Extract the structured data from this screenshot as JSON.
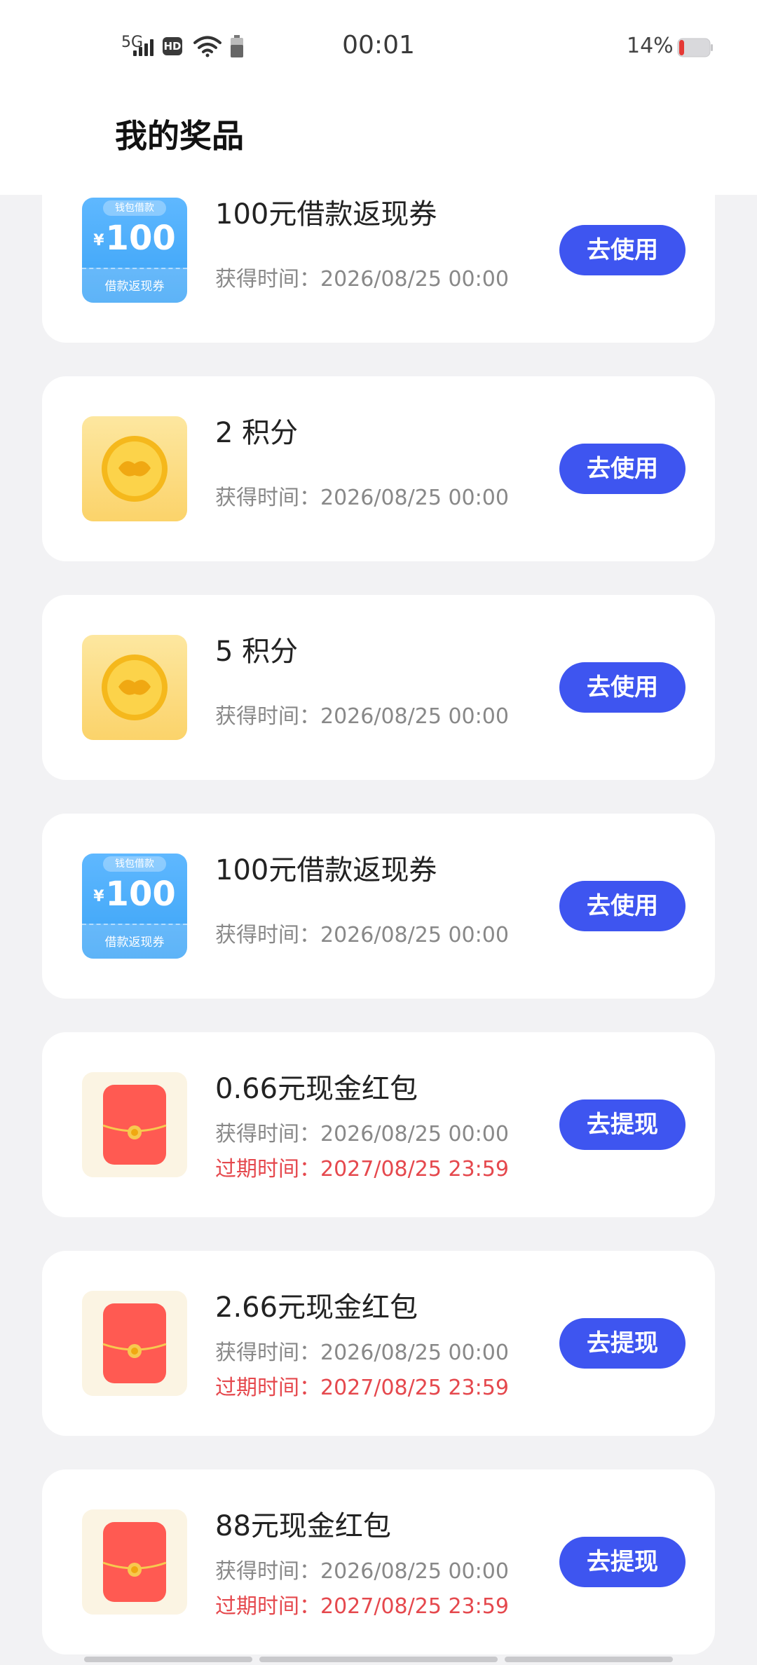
{
  "status_bar": {
    "network": "5G",
    "hd": "HD",
    "time": "00:01",
    "battery_percent": "14%"
  },
  "header": {
    "title": "我的奖品"
  },
  "prizes": [
    {
      "type": "voucher",
      "name": "100元借款返现券",
      "thumb_top": "钱包借款",
      "thumb_amount": "100",
      "thumb_currency": "¥",
      "thumb_bottom": "借款返现券",
      "gained": "获得时间：2026/08/25 00:00",
      "expire": "",
      "action": "去使用"
    },
    {
      "type": "coin",
      "name": "2 积分",
      "gained": "获得时间：2026/08/25 00:00",
      "expire": "",
      "action": "去使用"
    },
    {
      "type": "coin",
      "name": "5 积分",
      "gained": "获得时间：2026/08/25 00:00",
      "expire": "",
      "action": "去使用"
    },
    {
      "type": "voucher",
      "name": "100元借款返现券",
      "thumb_top": "钱包借款",
      "thumb_amount": "100",
      "thumb_currency": "¥",
      "thumb_bottom": "借款返现券",
      "gained": "获得时间：2026/08/25 00:00",
      "expire": "",
      "action": "去使用"
    },
    {
      "type": "red",
      "name": "0.66元现金红包",
      "gained": "获得时间：2026/08/25 00:00",
      "expire": "过期时间：2027/08/25 23:59",
      "action": "去提现"
    },
    {
      "type": "red",
      "name": "2.66元现金红包",
      "gained": "获得时间：2026/08/25 00:00",
      "expire": "过期时间：2027/08/25 23:59",
      "action": "去提现"
    },
    {
      "type": "red",
      "name": "88元现金红包",
      "gained": "获得时间：2026/08/25 00:00",
      "expire": "过期时间：2027/08/25 23:59",
      "action": "去提现"
    }
  ],
  "colors": {
    "accent": "#3e55f0",
    "expire_red": "#e5484d",
    "background": "#f2f2f4"
  }
}
